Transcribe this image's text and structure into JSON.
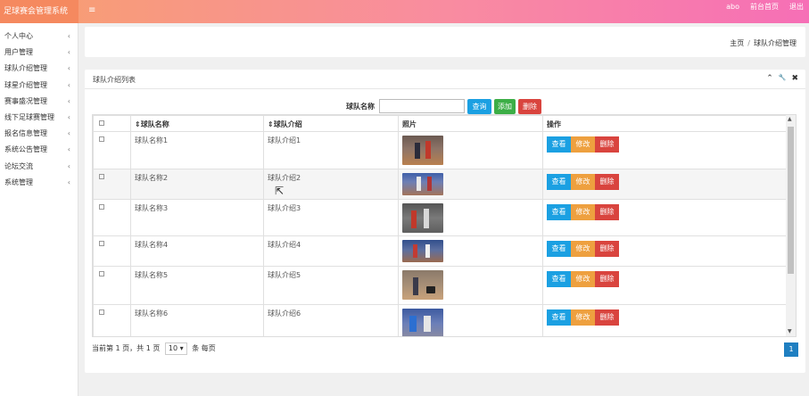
{
  "app": {
    "title": "足球赛会管理系统",
    "menu_toggle": "≡"
  },
  "top_links": [
    "abo",
    "前台首页",
    "退出"
  ],
  "sidebar": {
    "items": [
      {
        "label": "个人中心"
      },
      {
        "label": "用户管理"
      },
      {
        "label": "球队介绍管理"
      },
      {
        "label": "球星介绍管理"
      },
      {
        "label": "赛事盛况管理"
      },
      {
        "label": "线下足球赛管理"
      },
      {
        "label": "报名信息管理"
      },
      {
        "label": "系统公告管理"
      },
      {
        "label": "论坛交流"
      },
      {
        "label": "系统管理"
      }
    ],
    "chevron": "‹"
  },
  "breadcrumb": {
    "home": "主页",
    "sep": "/",
    "current": "球队介绍管理"
  },
  "panel": {
    "title": "球队介绍列表",
    "tools": [
      "⌃",
      "🔧",
      "✖"
    ]
  },
  "search": {
    "label": "球队名称",
    "value": "",
    "placeholder": "",
    "search_btn": "查询",
    "add_btn": "添加",
    "delete_btn": "删除"
  },
  "table": {
    "headers": [
      "",
      "⇕球队名称",
      "⇕球队介绍",
      "照片",
      "操作"
    ],
    "rows": [
      {
        "name": "球队名称1",
        "intro": "球队介绍1"
      },
      {
        "name": "球队名称2",
        "intro": "球队介绍2"
      },
      {
        "name": "球队名称3",
        "intro": "球队介绍3"
      },
      {
        "name": "球队名称4",
        "intro": "球队介绍4"
      },
      {
        "name": "球队名称5",
        "intro": "球队介绍5"
      },
      {
        "name": "球队名称6",
        "intro": "球队介绍6"
      }
    ],
    "actions": {
      "view": "查看",
      "edit": "修改",
      "delete": "删除"
    }
  },
  "pager": {
    "text": "当前第 1 页，共 1 页",
    "page_size": "10",
    "suffix": "条 每页",
    "current_page": "1"
  },
  "colors": {
    "accent_blue": "#1ba0e2",
    "green": "#3cae46",
    "red": "#d9443e",
    "orange": "#eea03f"
  }
}
